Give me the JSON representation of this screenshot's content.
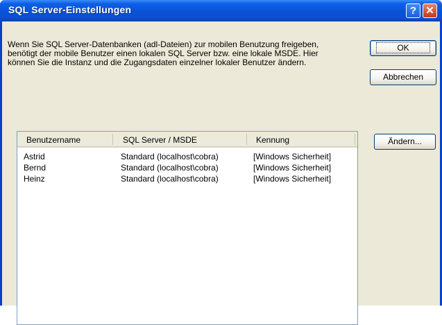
{
  "window": {
    "title": "SQL Server-Einstellungen",
    "help_glyph": "?",
    "close_glyph": "✕"
  },
  "description": "Wenn Sie SQL Server-Datenbanken (adl-Dateien) zur mobilen Benutzung freigeben, benötigt der mobile Benutzer einen lokalen SQL Server bzw. eine lokale MSDE. Hier können Sie die Instanz und die Zugangsdaten einzelner lokaler Benutzer ändern.",
  "buttons": {
    "ok": "OK",
    "cancel": "Abbrechen",
    "change": "Ändern..."
  },
  "table": {
    "columns": [
      "Benutzername",
      "SQL Server / MSDE",
      "Kennung"
    ],
    "rows": [
      [
        "Astrid",
        "Standard (localhost\\cobra)",
        "[Windows Sicherheit]"
      ],
      [
        "Bernd",
        "Standard (localhost\\cobra)",
        "[Windows Sicherheit]"
      ],
      [
        "Heinz",
        "Standard (localhost\\cobra)",
        "[Windows Sicherheit]"
      ]
    ]
  }
}
